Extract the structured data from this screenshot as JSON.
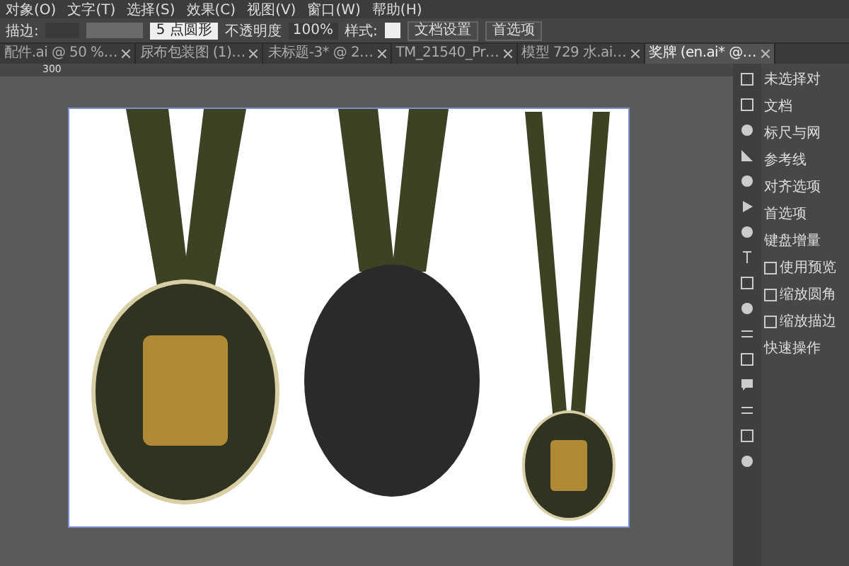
{
  "menu": [
    "对象(O)",
    "文字(T)",
    "选择(S)",
    "效果(C)",
    "视图(V)",
    "窗口(W)",
    "帮助(H)"
  ],
  "control_bar": {
    "stroke_label": "描边:",
    "brush": "5 点圆形",
    "opacity_label": "不透明度",
    "opacity": "100%",
    "style_label": "样式:",
    "buttons": [
      "文档设置",
      "首选项"
    ]
  },
  "tabs": [
    {
      "label": "配件.ai @ 50 %…",
      "selected": false
    },
    {
      "label": "尿布包装图 (1)…",
      "selected": false
    },
    {
      "label": "未标题-3* @ 2…",
      "selected": false
    },
    {
      "label": "TM_21540_Pr…",
      "selected": false
    },
    {
      "label": "模型 729 水.ai…",
      "selected": false
    },
    {
      "label": "奖牌 (en.ai* @…",
      "selected": true
    }
  ],
  "ruler": {
    "mark": "300"
  },
  "panel": {
    "title": "未选择对",
    "items": [
      {
        "kind": "heading",
        "label": "文档"
      },
      {
        "kind": "heading",
        "label": "标尺与网"
      },
      {
        "kind": "heading",
        "label": "参考线"
      },
      {
        "kind": "heading",
        "label": "对齐选项"
      },
      {
        "kind": "heading",
        "label": "首选项"
      },
      {
        "kind": "heading",
        "label": "键盘增量"
      },
      {
        "kind": "checkbox",
        "label": "使用预览",
        "checked": false
      },
      {
        "kind": "checkbox",
        "label": "缩放圆角",
        "checked": false
      },
      {
        "kind": "checkbox",
        "label": "缩放描边",
        "checked": false
      },
      {
        "kind": "heading",
        "label": "快速操作"
      }
    ]
  }
}
